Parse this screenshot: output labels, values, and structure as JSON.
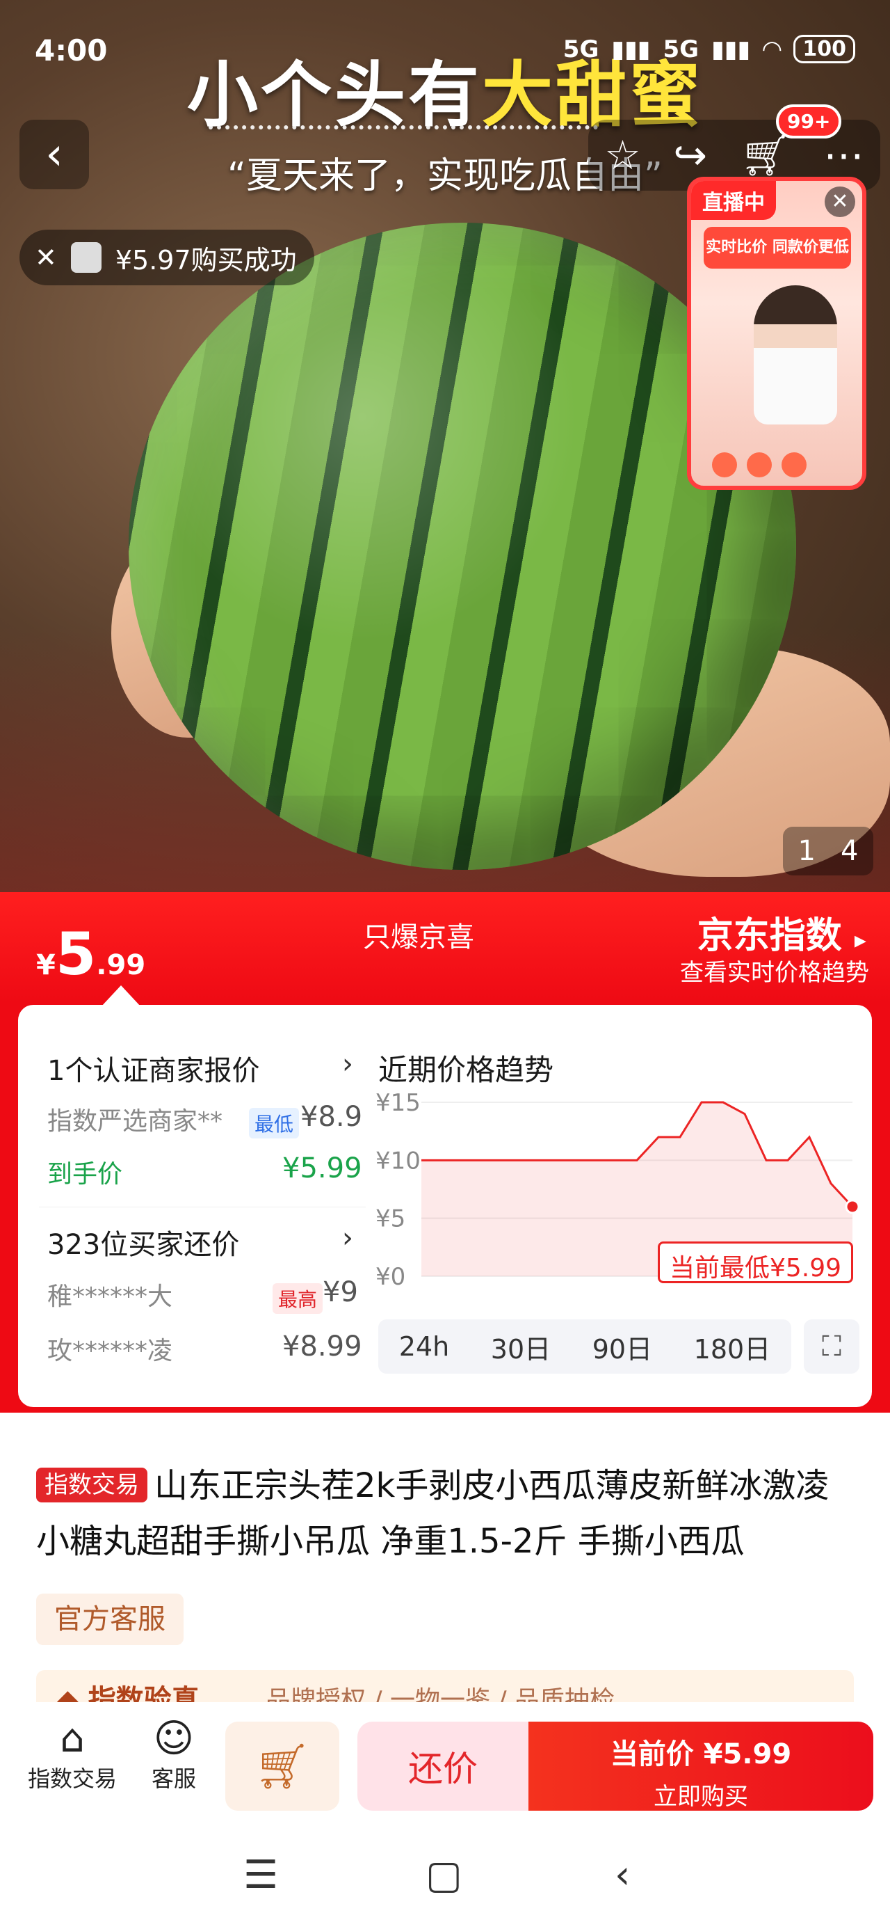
{
  "status_bar": {
    "time": "4:00",
    "signal1": "5G",
    "signal2": "5G",
    "battery": "100"
  },
  "hero": {
    "headline_part1": "小个头有",
    "headline_part2": "大甜蜜",
    "subline": "“夏天来了，实现吃瓜自由”",
    "cart_badge": "99+",
    "toast_text": "¥5.97购买成功",
    "pager_current": "1",
    "pager_total": "4"
  },
  "live_window": {
    "tag": "直播中",
    "banner": "实时比价 同款价更低"
  },
  "price": {
    "currency": "¥",
    "integer": "5",
    "decimal": ".99",
    "slogan": "只爆京喜",
    "jd_index_title": "京东指数",
    "jd_index_sub": "查看实时价格趋势"
  },
  "merchants": {
    "title": "1个认证商家报价",
    "merchant_name": "指数严选商家**",
    "lowest_tag": "最低",
    "merchant_price": "¥8.9",
    "final_label": "到手价",
    "final_price": "¥5.99"
  },
  "bargain": {
    "title": "323位买家还价",
    "buyers": [
      {
        "name": "稚******大",
        "tag": "最高",
        "price": "¥9"
      },
      {
        "name": "玫******凌",
        "tag": "",
        "price": "¥8.99"
      }
    ]
  },
  "trend": {
    "title": "近期价格趋势",
    "current_low_label": "当前最低¥5.99",
    "tabs": [
      "24h",
      "30日",
      "90日",
      "180日"
    ]
  },
  "chart_data": {
    "type": "area",
    "title": "近期价格趋势",
    "ylabel": "",
    "yticks": [
      "¥15",
      "¥10",
      "¥5",
      "¥0"
    ],
    "ylim": [
      0,
      15
    ],
    "x": [
      0,
      10,
      20,
      30,
      40,
      50,
      55,
      60,
      65,
      70,
      75,
      80,
      85,
      90,
      95,
      100
    ],
    "values": [
      10,
      10,
      10,
      10,
      10,
      10,
      12,
      12,
      15,
      15,
      14,
      10,
      10,
      12,
      8,
      6
    ],
    "grid": true
  },
  "product": {
    "tag": "指数交易",
    "title": "山东正宗头茬2k手剥皮小西瓜薄皮新鲜冰激凌小糖丸超甜手撕小吊瓜 净重1.5-2斤 手撕小西瓜",
    "official_badge": "官方客服",
    "verify_title": "指数验真",
    "verify_items": "品牌授权 / 一物一鉴 / 品质抽检"
  },
  "bottom_bar": {
    "index_trade": "指数交易",
    "service": "客服",
    "bargain_btn": "还价",
    "buy_line1": "当前价 ¥5.99",
    "buy_line2": "立即购买"
  }
}
